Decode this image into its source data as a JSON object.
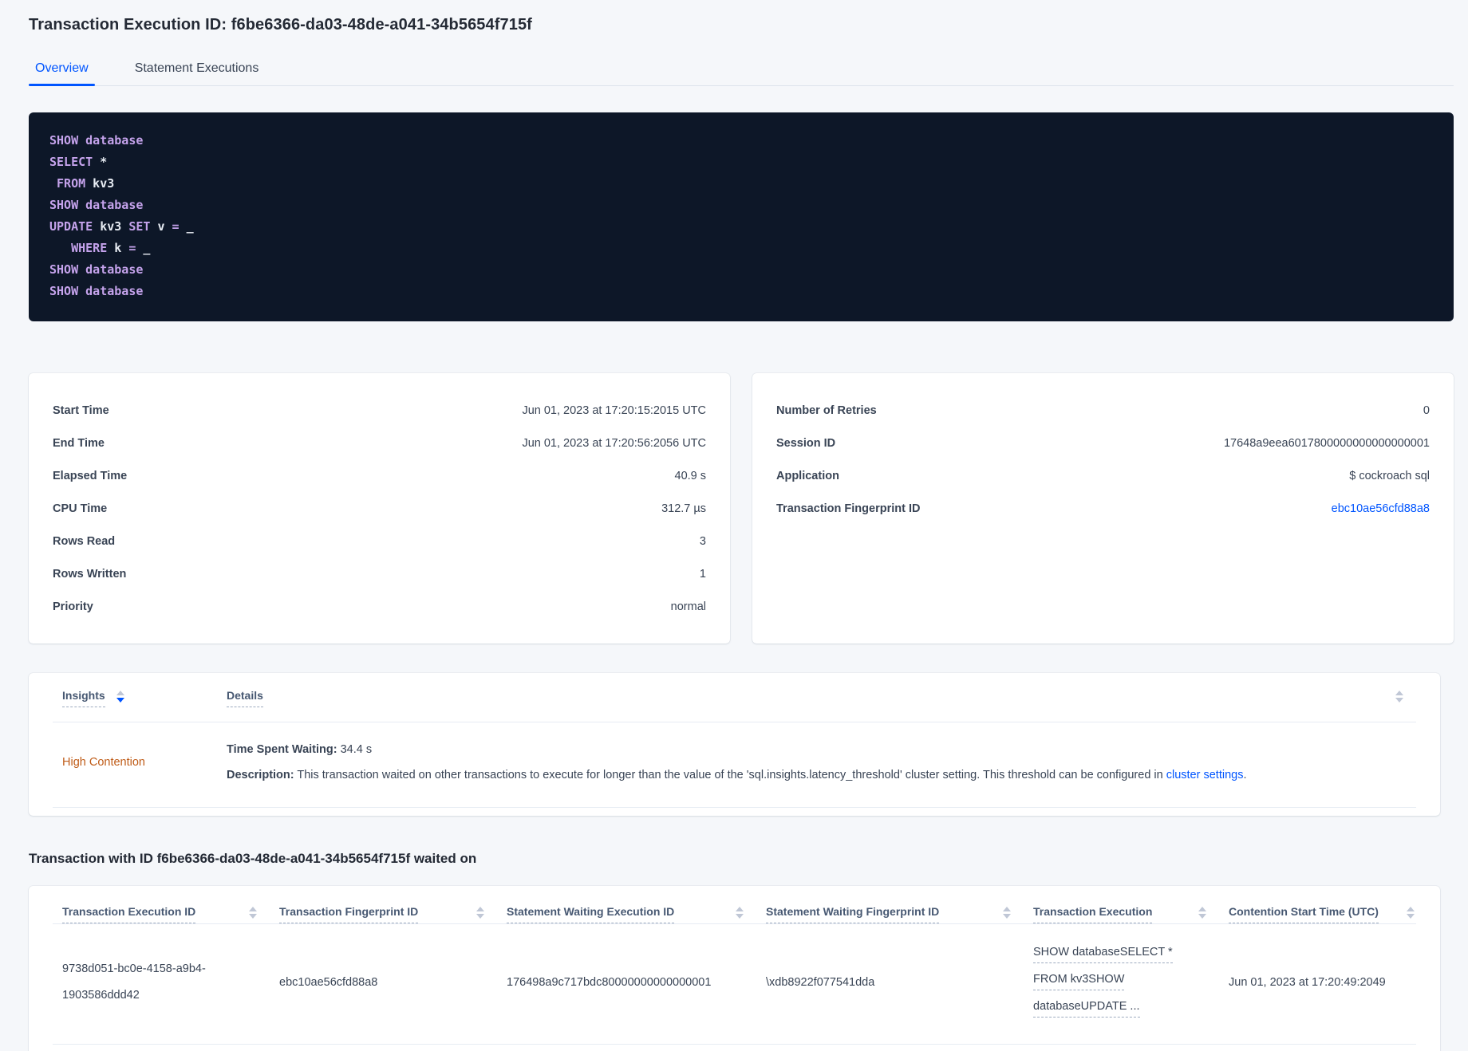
{
  "page": {
    "title": "Transaction Execution ID: f6be6366-da03-48de-a041-34b5654f715f"
  },
  "tabs": {
    "overview": "Overview",
    "statement_executions": "Statement Executions"
  },
  "code": {
    "lines": [
      [
        {
          "c": "kw",
          "t": "SHOW database"
        }
      ],
      [
        {
          "c": "kw",
          "t": "SELECT"
        },
        {
          "c": "pl",
          "t": " *"
        }
      ],
      [
        {
          "c": "pl",
          "t": " "
        },
        {
          "c": "kw",
          "t": "FROM"
        },
        {
          "c": "pl",
          "t": " kv3"
        }
      ],
      [
        {
          "c": "kw",
          "t": "SHOW database"
        }
      ],
      [
        {
          "c": "kw",
          "t": "UPDATE"
        },
        {
          "c": "pl",
          "t": " kv3 "
        },
        {
          "c": "kw",
          "t": "SET"
        },
        {
          "c": "pl",
          "t": " v "
        },
        {
          "c": "kw",
          "t": "="
        },
        {
          "c": "pl",
          "t": " _"
        }
      ],
      [
        {
          "c": "pl",
          "t": "   "
        },
        {
          "c": "kw",
          "t": "WHERE"
        },
        {
          "c": "pl",
          "t": " k "
        },
        {
          "c": "kw",
          "t": "="
        },
        {
          "c": "pl",
          "t": " _"
        }
      ],
      [
        {
          "c": "kw",
          "t": "SHOW database"
        }
      ],
      [
        {
          "c": "kw",
          "t": "SHOW database"
        }
      ]
    ]
  },
  "summary_left": {
    "rows": [
      {
        "label": "Start Time",
        "value": "Jun 01, 2023 at 17:20:15:2015 UTC"
      },
      {
        "label": "End Time",
        "value": "Jun 01, 2023 at 17:20:56:2056 UTC"
      },
      {
        "label": "Elapsed Time",
        "value": "40.9 s"
      },
      {
        "label": "CPU Time",
        "value": "312.7 µs"
      },
      {
        "label": "Rows Read",
        "value": "3"
      },
      {
        "label": "Rows Written",
        "value": "1"
      },
      {
        "label": "Priority",
        "value": "normal"
      }
    ]
  },
  "summary_right": {
    "rows": [
      {
        "label": "Number of Retries",
        "value": "0"
      },
      {
        "label": "Session ID",
        "value": "17648a9eea6017800000000000000001"
      },
      {
        "label": "Application",
        "value": "$ cockroach sql"
      },
      {
        "label": "Transaction Fingerprint ID",
        "value": "ebc10ae56cfd88a8"
      }
    ]
  },
  "insights": {
    "col_insights": "Insights",
    "col_details": "Details",
    "row": {
      "insight": "High Contention",
      "waiting_label": "Time Spent Waiting:",
      "waiting_value": " 34.4 s",
      "desc_label": "Description:",
      "desc_text": " This transaction waited on other transactions to execute for longer than the value of the 'sql.insights.latency_threshold' cluster setting. This threshold can be configured in ",
      "desc_link": "cluster settings",
      "desc_period": "."
    }
  },
  "waited": {
    "heading": "Transaction with ID f6be6366-da03-48de-a041-34b5654f715f waited on",
    "columns": [
      "Transaction Execution ID",
      "Transaction Fingerprint ID",
      "Statement Waiting Execution ID",
      "Statement Waiting Fingerprint ID",
      "Transaction Execution",
      "Contention Start Time (UTC)"
    ],
    "row": {
      "txn_execution_id": "9738d051-bc0e-4158-a9b4-1903586ddd42",
      "txn_fingerprint_id": "ebc10ae56cfd88a8",
      "stmt_waiting_execution_id": "176498a9c717bdc80000000000000001",
      "stmt_waiting_fingerprint_id": "\\xdb8922f077541dda",
      "txn_execution_lines": [
        "SHOW databaseSELECT *",
        "FROM kv3SHOW",
        "databaseUPDATE ..."
      ],
      "contention_start": "Jun 01, 2023 at 17:20:49:2049"
    }
  },
  "colors": {
    "accent_blue": "#0055ff",
    "insight_orange": "#bf5b17",
    "code_background": "#0d1728",
    "code_keyword": "#c5a3ec",
    "code_plain": "#e7ecf3",
    "page_background": "#f5f7fa"
  }
}
